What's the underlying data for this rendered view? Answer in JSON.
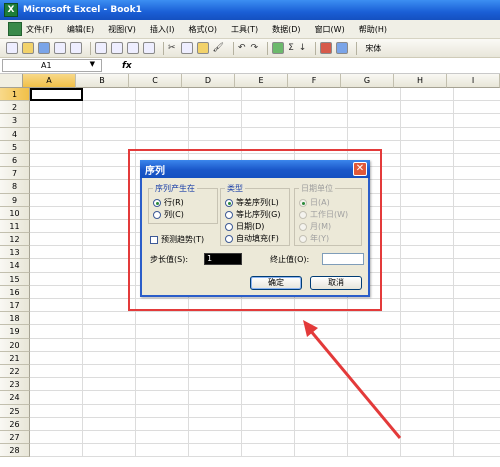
{
  "window": {
    "title": "Microsoft Excel - Book1",
    "app_icon_label": "X"
  },
  "menu": {
    "items": [
      "文件(F)",
      "编辑(E)",
      "视图(V)",
      "插入(I)",
      "格式(O)",
      "工具(T)",
      "数据(D)",
      "窗口(W)",
      "帮助(H)"
    ]
  },
  "toolbar": {
    "font_name": "宋体"
  },
  "formula_bar": {
    "name_box": "A1",
    "fx": "fx"
  },
  "columns": [
    "A",
    "B",
    "C",
    "D",
    "E",
    "F",
    "G",
    "H",
    "I"
  ],
  "rows": [
    "1",
    "2",
    "3",
    "4",
    "5",
    "6",
    "7",
    "8",
    "9",
    "10",
    "11",
    "12",
    "13",
    "14",
    "15",
    "16",
    "17",
    "18",
    "19",
    "20",
    "21",
    "22",
    "23",
    "24",
    "25",
    "26",
    "27",
    "28"
  ],
  "dialog": {
    "title": "序列",
    "close": "✕",
    "series_in": {
      "legend": "序列产生在",
      "options": [
        {
          "label": "行(R)",
          "checked": true
        },
        {
          "label": "列(C)",
          "checked": false
        }
      ]
    },
    "type": {
      "legend": "类型",
      "options": [
        {
          "label": "等差序列(L)",
          "checked": true
        },
        {
          "label": "等比序列(G)",
          "checked": false
        },
        {
          "label": "日期(D)",
          "checked": false
        },
        {
          "label": "自动填充(F)",
          "checked": false
        }
      ]
    },
    "date_unit": {
      "legend": "日期单位",
      "options": [
        {
          "label": "日(A)"
        },
        {
          "label": "工作日(W)"
        },
        {
          "label": "月(M)"
        },
        {
          "label": "年(Y)"
        }
      ]
    },
    "trend": {
      "label": "预测趋势(T)",
      "checked": false
    },
    "step": {
      "label": "步长值(S):",
      "value": "1"
    },
    "stop": {
      "label": "终止值(O):",
      "value": ""
    },
    "ok_label": "确定",
    "cancel_label": "取消"
  },
  "colors": {
    "annotation": "#e33a3a",
    "titlebar": "#1a5fd6"
  }
}
